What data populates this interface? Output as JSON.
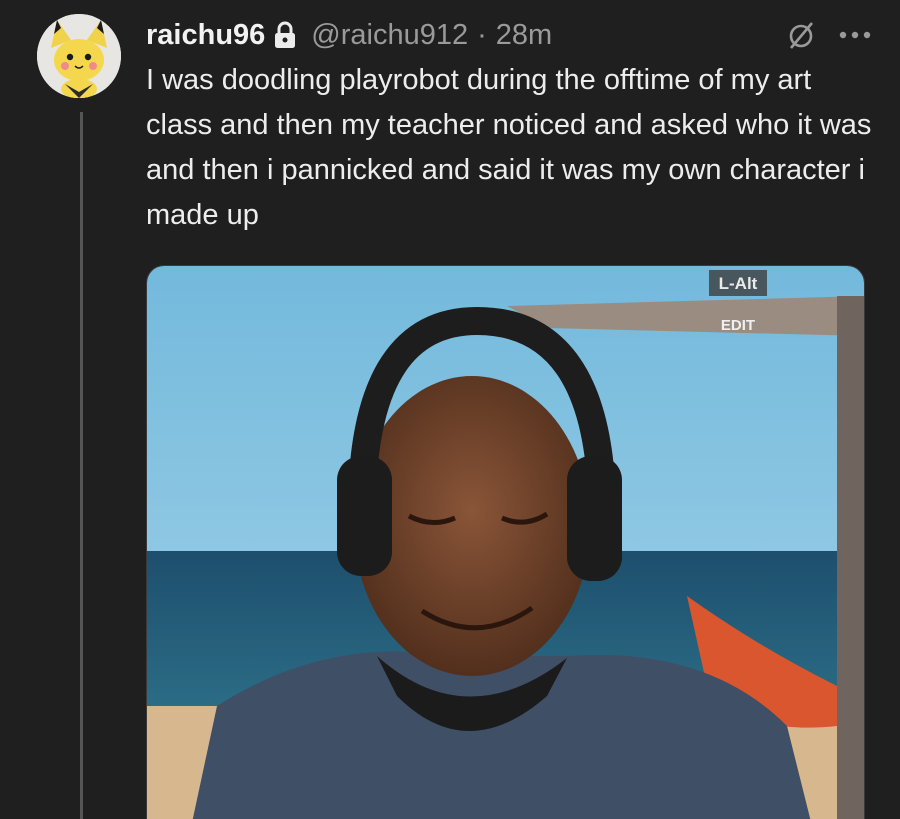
{
  "post": {
    "display_name": "raichu96",
    "handle": "@raichu912",
    "separator": "·",
    "time": "28m",
    "text": "I was doodling playrobot during the offtime of my art class and then my teacher noticed and asked who it was and then i pannicked and said it was my own character i made up",
    "icons": {
      "lock": "lock-icon",
      "repost_toggle": "slashed-circle-icon",
      "more": "more-options-icon"
    },
    "more_label": "•••"
  },
  "media": {
    "overlay_label_1": "L-Alt",
    "overlay_label_2": "EDIT"
  },
  "colors": {
    "background": "#1f1f1f",
    "text": "#ededed",
    "muted": "#9a9a9a",
    "thread_line": "#555555"
  }
}
